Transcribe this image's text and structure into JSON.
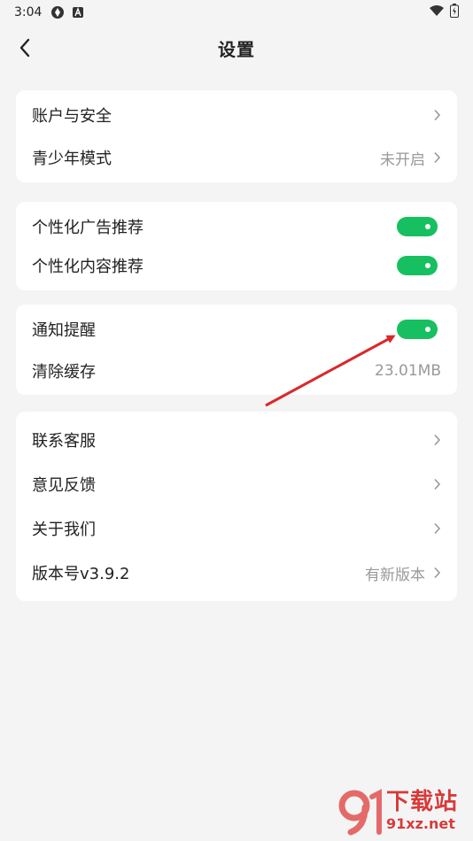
{
  "status_bar": {
    "time": "3:04"
  },
  "header": {
    "title": "设置"
  },
  "groups": {
    "account": {
      "account_security": "账户与安全",
      "teen_mode": "青少年模式",
      "teen_mode_value": "未开启"
    },
    "recommend": {
      "ad_recommend": "个性化广告推荐",
      "content_recommend": "个性化内容推荐"
    },
    "general": {
      "notification": "通知提醒",
      "clear_cache": "清除缓存",
      "cache_size": "23.01MB"
    },
    "about": {
      "contact": "联系客服",
      "feedback": "意见反馈",
      "about_us": "关于我们",
      "version": "版本号v3.9.2",
      "version_status": "有新版本"
    }
  },
  "toggles": {
    "ad_recommend_on": true,
    "content_recommend_on": true,
    "notification_on": true
  },
  "colors": {
    "toggle_on": "#16c060",
    "annotation_arrow": "#d9282a",
    "watermark": "#d83a3a"
  },
  "watermark": {
    "brand": "下载站",
    "url": "91xz.net"
  }
}
